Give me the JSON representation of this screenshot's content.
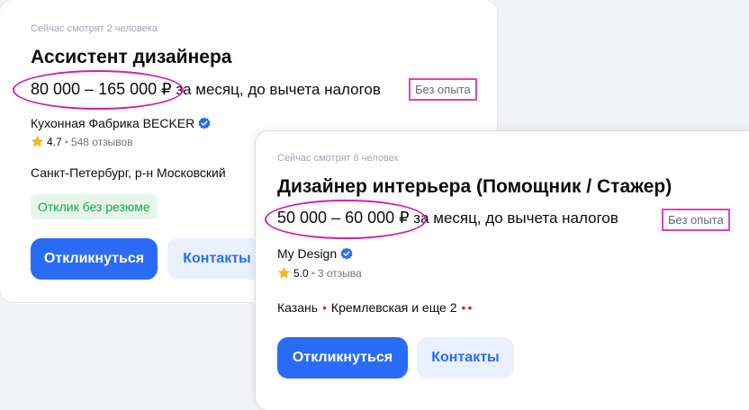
{
  "cards": [
    {
      "watching": "Сейчас смотрят 2 человека",
      "title": "Ассистент дизайнера",
      "salary": "80 000 – 165 000 ₽",
      "salary_tail": " за месяц, до вычета налогов",
      "experience": "Без опыта",
      "company": "Кухонная Фабрика BECKER",
      "rating": "4.7",
      "reviews": "548 отзывов",
      "location": "Санкт-Петербург, р-н Московский",
      "badge": "Отклик без резюме",
      "apply_label": "Откликнуться",
      "contacts_label": "Контакты"
    },
    {
      "watching": "Сейчас смотрят 6 человек",
      "title": "Дизайнер интерьера (Помощник / Стажер)",
      "salary": "50 000 – 60 000 ₽",
      "salary_tail": " за месяц, до вычета налогов",
      "experience": "Без опыта",
      "company": "My Design",
      "rating": "5.0",
      "reviews": "3 отзыва",
      "city": "Казань",
      "metro": "Кремлевская и еще 2",
      "apply_label": "Откликнуться",
      "contacts_label": "Контакты"
    }
  ],
  "colors": {
    "accent": "#2b6cf6",
    "highlight": "#d020b0",
    "metro": "#e01e28",
    "success": "#1aa34a"
  },
  "icons": [
    "verified-check-icon",
    "star-icon"
  ]
}
